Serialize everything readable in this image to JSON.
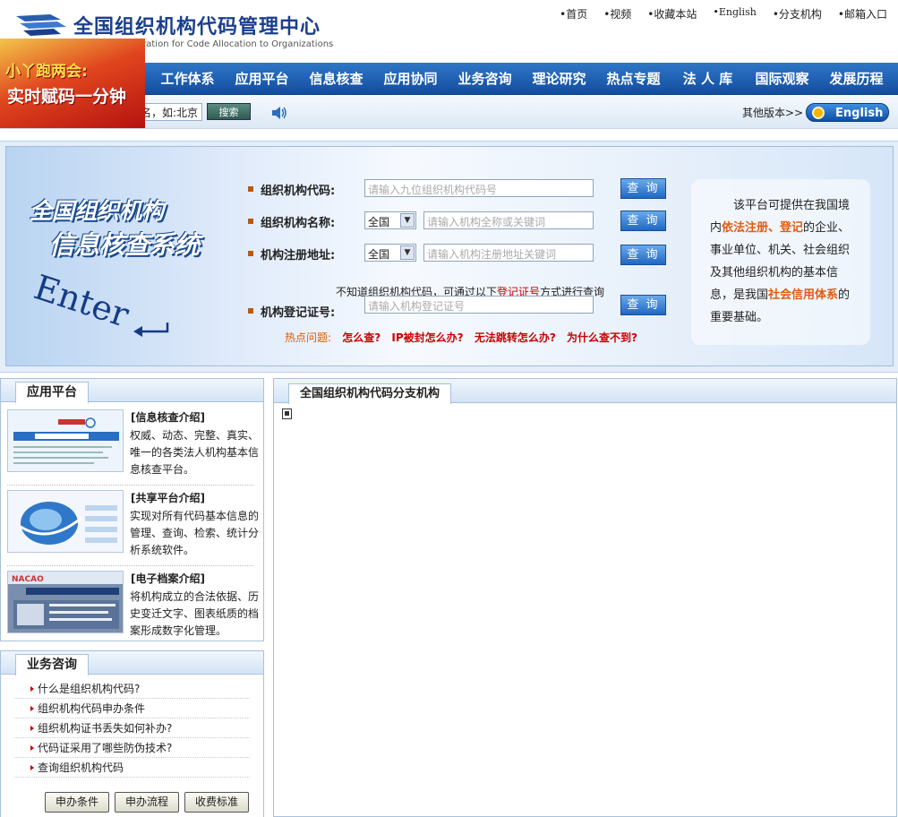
{
  "header": {
    "site_title": "全国组织机构代码管理中心",
    "site_subtitle": "stration for Code Allocation to Organizations",
    "top_links": [
      "•首页",
      "•视频",
      "•收藏本站",
      "•English",
      "•分支机构",
      "•邮箱入口"
    ]
  },
  "promo": {
    "line1": "小丫跑两会:",
    "line2": "实时赋码一分钟"
  },
  "nav": {
    "items": [
      "工作体系",
      "应用平台",
      "信息核查",
      "应用协同",
      "业务咨询",
      "理论研究",
      "热点专题",
      "法 人 库",
      "国际观察",
      "发展历程"
    ]
  },
  "subbar": {
    "search_value": "名，如:北京",
    "search_button": "搜索",
    "other_versions": "其他版本>>",
    "english_button": "English"
  },
  "banner": {
    "title_line1": "全国组织机构",
    "title_line2": "信息核查系统",
    "enter_text": "Enter",
    "fields": [
      {
        "label": "组织机构代码:",
        "placeholder": "请输入九位组织机构代码号",
        "button": "查 询"
      },
      {
        "label": "组织机构名称:",
        "select": "全国",
        "placeholder": "请输入机构全称或关键词",
        "button": "查 询"
      },
      {
        "label": "机构注册地址:",
        "select": "全国",
        "placeholder": "请输入机构注册地址关键词",
        "button": "查 询"
      },
      {
        "label": "机构登记证号:",
        "placeholder": "请输入机构登记证号",
        "button": "查 询"
      }
    ],
    "hint_before": "不知道组织机构代码，可通过以下",
    "hint_link": "登记证号",
    "hint_after": "方式进行查询",
    "hot_label": "热点问题:",
    "hot_questions": [
      "怎么查?",
      "IP被封怎么办?",
      "无法跳转怎么办?",
      "为什么查不到?"
    ],
    "info": {
      "part1": "该平台可提供在我国境内",
      "hl1": "依法注册、登记",
      "part2": "的企业、事业单位、机关、社会组织及其他组织机构的基本信息，是我国",
      "hl2": "社会信用体系",
      "part3": "的重要基础。"
    }
  },
  "app_platform": {
    "tab": "应用平台",
    "items": [
      {
        "title": "[信息核查介绍]",
        "desc": "权威、动态、完整、真实、唯一的各类法人机构基本信息核查平台。"
      },
      {
        "title": "[共享平台介绍]",
        "desc": "实现对所有代码基本信息的管理、查询、检索、统计分析系统软件。"
      },
      {
        "title": "[电子档案介绍]",
        "desc": "将机构成立的合法依据、历史变迁文字、图表纸质的档案形成数字化管理。"
      }
    ]
  },
  "consult": {
    "tab": "业务咨询",
    "items": [
      "什么是组织机构代码?",
      "组织机构代码申办条件",
      "组织机构证书丢失如何补办?",
      "代码证采用了哪些防伪技术?",
      "查询组织机构代码"
    ],
    "buttons": [
      "申办条件",
      "申办流程",
      "收费标准"
    ]
  },
  "branch": {
    "tab": "全国组织机构代码分支机构"
  }
}
